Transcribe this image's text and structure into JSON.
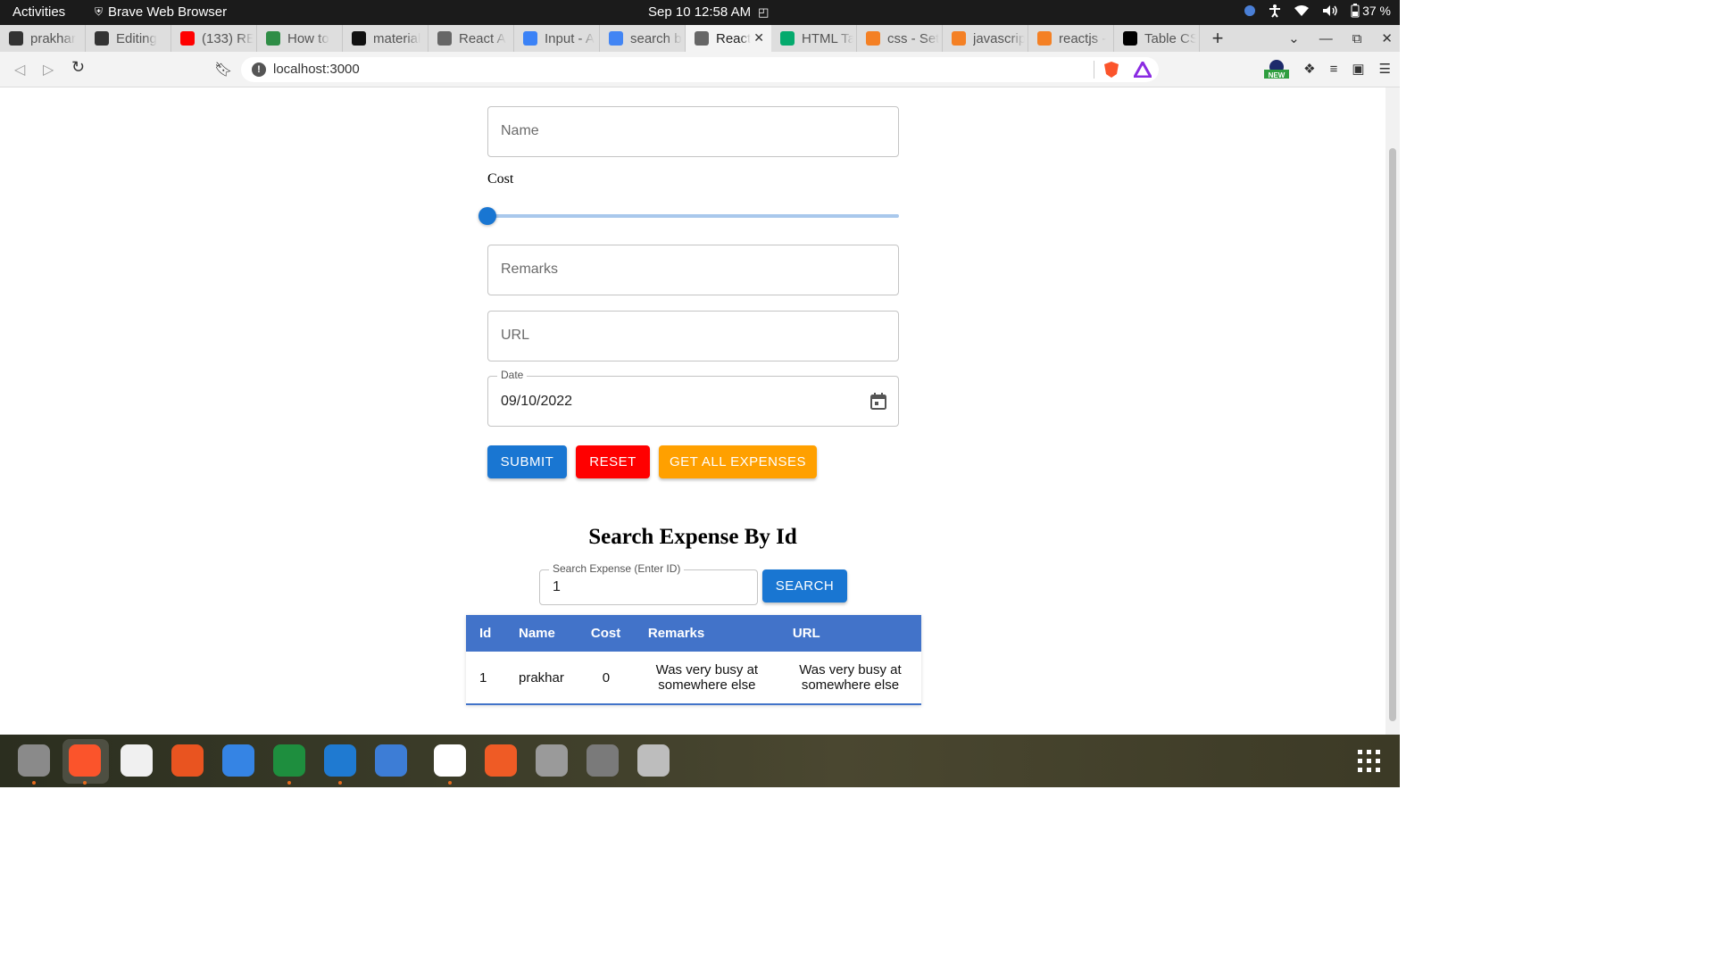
{
  "topbar": {
    "activities": "Activities",
    "app_name": "Brave Web Browser",
    "datetime": "Sep 10  12:58 AM",
    "battery": "37 %"
  },
  "tabs": [
    {
      "title": "prakhar",
      "icon": "github-icon",
      "color": "#333333"
    },
    {
      "title": "Editing",
      "icon": "github-icon",
      "color": "#333333"
    },
    {
      "title": "(133) RE",
      "icon": "youtube-icon",
      "color": "#ff0000"
    },
    {
      "title": "How to",
      "icon": "geeks-icon",
      "color": "#2f8d46"
    },
    {
      "title": "material",
      "icon": "mui-icon",
      "color": "#111111"
    },
    {
      "title": "React A",
      "icon": "globe-icon",
      "color": "#666666"
    },
    {
      "title": "Input - A",
      "icon": "diamond-icon",
      "color": "#3b82f6"
    },
    {
      "title": "search b",
      "icon": "google-icon",
      "color": "#4285f4"
    },
    {
      "title": "React",
      "icon": "globe-icon",
      "color": "#666666",
      "active": true
    },
    {
      "title": "HTML Ta",
      "icon": "w3-icon",
      "color": "#04aa6d"
    },
    {
      "title": "css - Set",
      "icon": "stackoverflow-icon",
      "color": "#f48024"
    },
    {
      "title": "javascrip",
      "icon": "stackoverflow-icon",
      "color": "#f48024"
    },
    {
      "title": "reactjs -",
      "icon": "stackoverflow-icon",
      "color": "#f48024"
    },
    {
      "title": "Table CS",
      "icon": "dev-icon",
      "color": "#000000"
    }
  ],
  "address": {
    "url": "localhost:3000"
  },
  "form": {
    "name_placeholder": "Name",
    "cost_label": "Cost",
    "cost_value": 0,
    "remarks_placeholder": "Remarks",
    "url_placeholder": "URL",
    "date_label": "Date",
    "date_value": "09/10/2022",
    "submit_label": "SUBMIT",
    "reset_label": "RESET",
    "get_all_label": "GET ALL EXPENSES"
  },
  "colors": {
    "primary": "#1976d2",
    "reset": "#ff0000",
    "get_all": "#ffa000",
    "table_header": "#4273c9"
  },
  "search": {
    "heading": "Search Expense By Id",
    "input_label": "Search Expense (Enter ID)",
    "input_value": "1",
    "button_label": "SEARCH"
  },
  "table": {
    "headers": [
      "Id",
      "Name",
      "Cost",
      "Remarks",
      "URL"
    ],
    "rows": [
      [
        "1",
        "prakhar",
        "0",
        "Was very busy at somewhere else",
        "Was very busy at somewhere else"
      ]
    ]
  },
  "dock": [
    {
      "name": "files-icon",
      "color": "#8a8a8a"
    },
    {
      "name": "brave-icon",
      "color": "#fb542b"
    },
    {
      "name": "rhythmbox-icon",
      "color": "#f0f0f0"
    },
    {
      "name": "software-icon",
      "color": "#e95420"
    },
    {
      "name": "help-icon",
      "color": "#3584e4"
    },
    {
      "name": "chrome-icon",
      "color": "#1e8e3e"
    },
    {
      "name": "vscode-icon",
      "color": "#1f7ad1"
    },
    {
      "name": "qbittorrent-icon",
      "color": "#3d7dd6"
    },
    {
      "name": "gimp-icon",
      "color": "#ffffff"
    },
    {
      "name": "postman-icon",
      "color": "#ef5b25"
    },
    {
      "name": "text-editor-icon",
      "color": "#9a9a9a"
    },
    {
      "name": "disks-icon",
      "color": "#7a7a7a"
    },
    {
      "name": "trash-icon",
      "color": "#bdbdbd"
    }
  ]
}
